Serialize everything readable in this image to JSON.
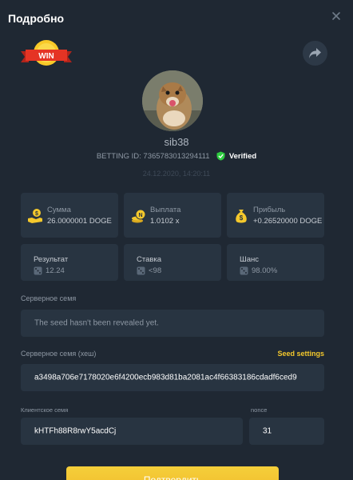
{
  "header": {
    "title": "Подробно"
  },
  "badge": {
    "text": "WIN"
  },
  "player": {
    "username": "sib38",
    "betting_id_label": "BETTING ID:",
    "betting_id": "7365783013294111",
    "verified_label": "Verified",
    "date": "24.12.2020, 14:20:11"
  },
  "stats": [
    {
      "icon": "money-hand-icon",
      "label": "Сумма",
      "value": "26.0000001 DOGE"
    },
    {
      "icon": "coin-stack-icon",
      "label": "Выплата",
      "value": "1.0102 x"
    },
    {
      "icon": "money-bag-icon",
      "label": "Прибыль",
      "value": "+0.26520000 DOGE"
    }
  ],
  "results": [
    {
      "icon": "dice-icon",
      "label": "Результат",
      "value": "12.24"
    },
    {
      "icon": "dice-icon",
      "label": "Ставка",
      "value": "<98"
    },
    {
      "icon": "dice-icon",
      "label": "Шанс",
      "value": "98.00%"
    }
  ],
  "server_seed": {
    "label": "Серверное семя",
    "value": "The seed hasn't been revealed yet."
  },
  "server_seed_hash": {
    "label": "Серверное семя (хеш)",
    "settings_link": "Seed settings",
    "value": "a3498a706e7178020e6f4200ecb983d81ba2081ac4f66383186cdadf6ced9"
  },
  "client_seed": {
    "label": "Клиентское семя",
    "value": "kHTFh88R8rwY5acdCj"
  },
  "nonce": {
    "label": "nonce",
    "value": "31"
  },
  "confirm_button": {
    "label": "Подтвердить"
  },
  "colors": {
    "background": "#1f2833",
    "card": "#283441",
    "accent": "#f4c82c",
    "verified": "#2ecc40"
  }
}
